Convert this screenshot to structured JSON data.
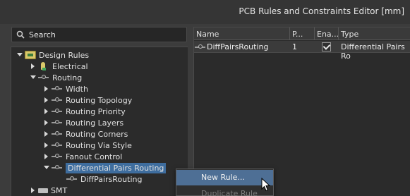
{
  "window": {
    "title": "PCB Rules and Constraints Editor [mm]"
  },
  "search": {
    "placeholder": "Search"
  },
  "tree": {
    "root": "Design Rules",
    "electrical": "Electrical",
    "routing": "Routing",
    "children": [
      "Width",
      "Routing Topology",
      "Routing Priority",
      "Routing Layers",
      "Routing Corners",
      "Routing Via Style",
      "Fanout Control",
      "Differential Pairs Routing"
    ],
    "leaf": "DiffPairsRouting",
    "smt": "SMT"
  },
  "table": {
    "headers": [
      "Name",
      "P...",
      "Ena...",
      "Type"
    ],
    "rows": [
      {
        "name": "DiffPairsRouting",
        "priority": "1",
        "enabled": true,
        "type": "Differential Pairs Ro"
      }
    ]
  },
  "context_menu": {
    "items": [
      {
        "label": "New Rule...",
        "highlighted": true,
        "enabled": true
      },
      {
        "label": "Duplicate Rule",
        "highlighted": false,
        "enabled": false
      }
    ]
  },
  "colors": {
    "background": "#3c3c3c",
    "panel": "#2b2b2b",
    "selection": "#3e6d9e",
    "menu_highlight": "#4e6f95"
  }
}
